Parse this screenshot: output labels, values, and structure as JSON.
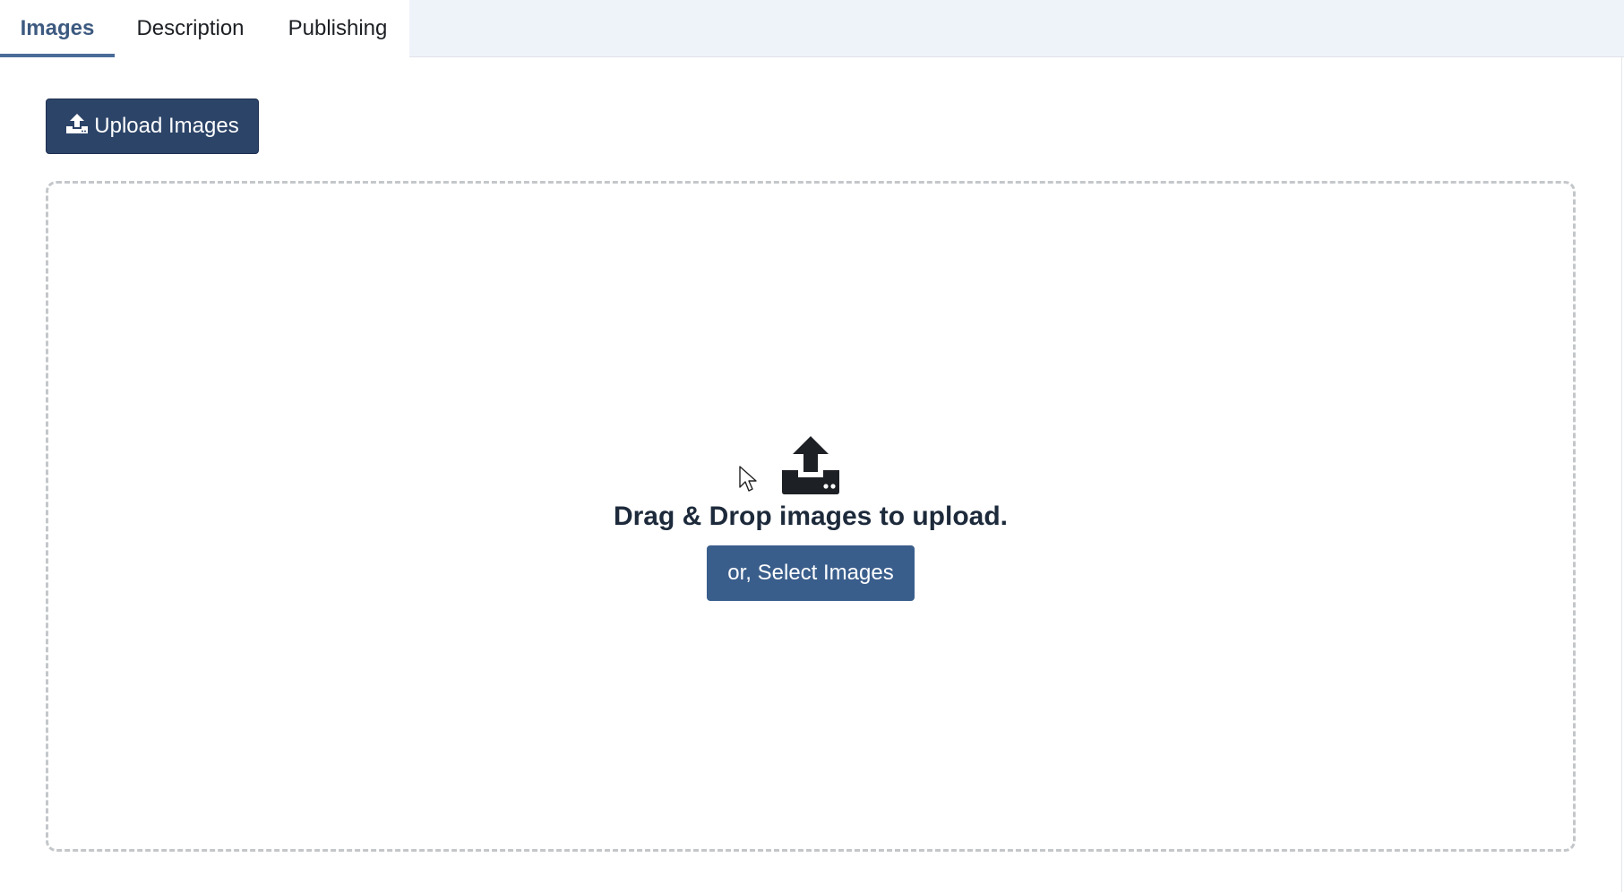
{
  "tabs": [
    {
      "label": "Images",
      "active": true
    },
    {
      "label": "Description",
      "active": false
    },
    {
      "label": "Publishing",
      "active": false
    }
  ],
  "toolbar": {
    "upload_label": "Upload Images",
    "upload_icon": "upload-icon"
  },
  "dropzone": {
    "icon": "upload-icon",
    "text": "Drag & Drop images to upload.",
    "select_label": "or, Select Images"
  },
  "colors": {
    "accent": "#3d5a80",
    "primary_button": "#2c4468",
    "secondary_button": "#3a5e8c",
    "tabbar_bg": "#eef3fa"
  }
}
